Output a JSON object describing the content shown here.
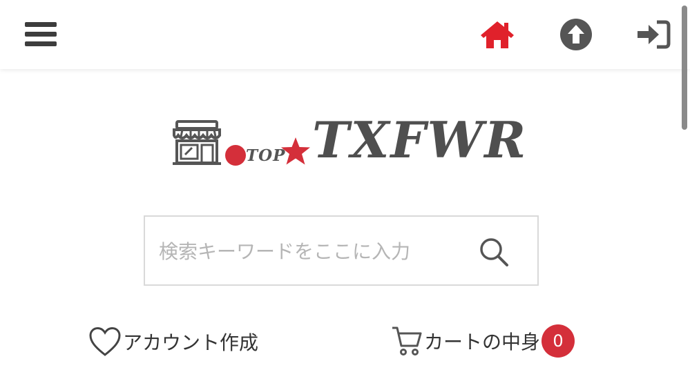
{
  "header": {
    "menu_icon": "hamburger-menu-icon",
    "home_icon": "home-icon",
    "up_icon": "arrow-up-circle-icon",
    "login_icon": "sign-in-icon",
    "home_color": "#e0212b",
    "icon_color": "#555555"
  },
  "logo": {
    "top_text": "TOP",
    "brand": "TXFWR",
    "accent_color": "#d42f3a"
  },
  "search": {
    "placeholder": "検索キーワードをここに入力",
    "value": ""
  },
  "links": {
    "account_label": "アカウント作成",
    "cart_label": "カートの中身",
    "cart_count": "0"
  }
}
